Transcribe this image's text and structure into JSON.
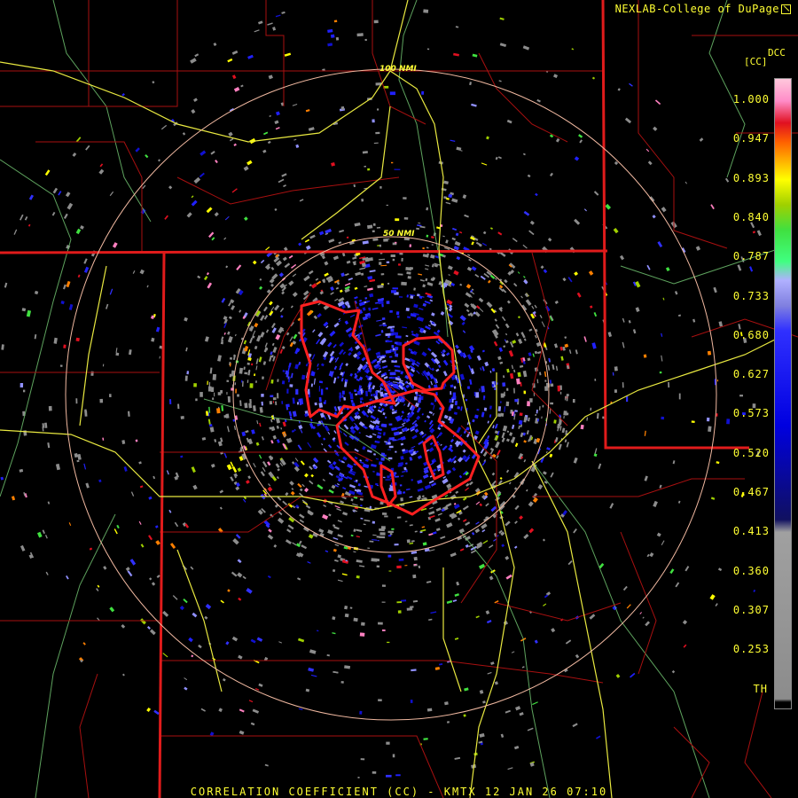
{
  "header": {
    "source": "NEXLAB-College of DuPage"
  },
  "legend": {
    "product_code": "DCC",
    "unit": "[CC]",
    "ticks": [
      "1.000",
      "0.947",
      "0.893",
      "0.840",
      "0.787",
      "0.733",
      "0.680",
      "0.627",
      "0.573",
      "0.520",
      "0.467",
      "0.413",
      "0.360",
      "0.307",
      "0.253",
      "TH"
    ]
  },
  "range_rings": {
    "inner": "50 NMI",
    "outer": "100 NMI"
  },
  "footer": "CORRELATION COEFFICIENT (CC) - KMTX 12 JAN 26 07:10",
  "colors": {
    "state_lines": "#e01b1b",
    "county_lines": "#a81010",
    "highways": "#e8e840",
    "rivers": "#7fc87f",
    "rings": "#f0b8a0",
    "text": "#ffff33",
    "warning_polygons": "#ff2020"
  }
}
